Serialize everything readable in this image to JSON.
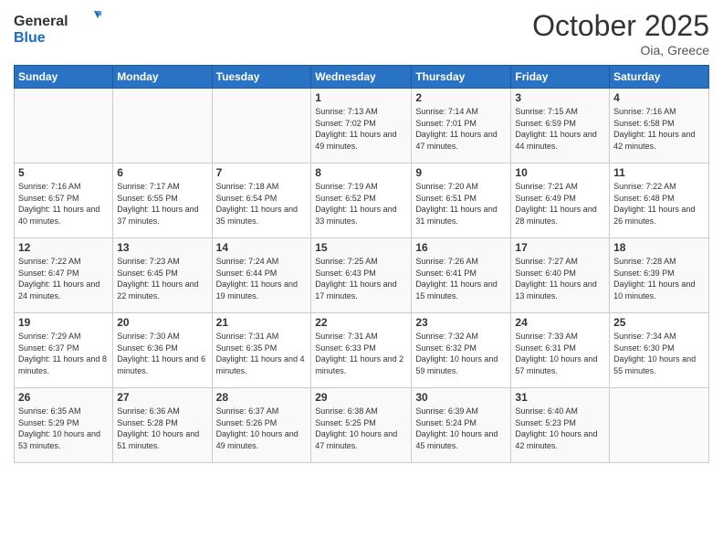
{
  "header": {
    "logo_general": "General",
    "logo_blue": "Blue",
    "month_title": "October 2025",
    "location": "Oia, Greece"
  },
  "weekdays": [
    "Sunday",
    "Monday",
    "Tuesday",
    "Wednesday",
    "Thursday",
    "Friday",
    "Saturday"
  ],
  "weeks": [
    [
      {
        "day": "",
        "sunrise": "",
        "sunset": "",
        "daylight": ""
      },
      {
        "day": "",
        "sunrise": "",
        "sunset": "",
        "daylight": ""
      },
      {
        "day": "",
        "sunrise": "",
        "sunset": "",
        "daylight": ""
      },
      {
        "day": "1",
        "sunrise": "Sunrise: 7:13 AM",
        "sunset": "Sunset: 7:02 PM",
        "daylight": "Daylight: 11 hours and 49 minutes."
      },
      {
        "day": "2",
        "sunrise": "Sunrise: 7:14 AM",
        "sunset": "Sunset: 7:01 PM",
        "daylight": "Daylight: 11 hours and 47 minutes."
      },
      {
        "day": "3",
        "sunrise": "Sunrise: 7:15 AM",
        "sunset": "Sunset: 6:59 PM",
        "daylight": "Daylight: 11 hours and 44 minutes."
      },
      {
        "day": "4",
        "sunrise": "Sunrise: 7:16 AM",
        "sunset": "Sunset: 6:58 PM",
        "daylight": "Daylight: 11 hours and 42 minutes."
      }
    ],
    [
      {
        "day": "5",
        "sunrise": "Sunrise: 7:16 AM",
        "sunset": "Sunset: 6:57 PM",
        "daylight": "Daylight: 11 hours and 40 minutes."
      },
      {
        "day": "6",
        "sunrise": "Sunrise: 7:17 AM",
        "sunset": "Sunset: 6:55 PM",
        "daylight": "Daylight: 11 hours and 37 minutes."
      },
      {
        "day": "7",
        "sunrise": "Sunrise: 7:18 AM",
        "sunset": "Sunset: 6:54 PM",
        "daylight": "Daylight: 11 hours and 35 minutes."
      },
      {
        "day": "8",
        "sunrise": "Sunrise: 7:19 AM",
        "sunset": "Sunset: 6:52 PM",
        "daylight": "Daylight: 11 hours and 33 minutes."
      },
      {
        "day": "9",
        "sunrise": "Sunrise: 7:20 AM",
        "sunset": "Sunset: 6:51 PM",
        "daylight": "Daylight: 11 hours and 31 minutes."
      },
      {
        "day": "10",
        "sunrise": "Sunrise: 7:21 AM",
        "sunset": "Sunset: 6:49 PM",
        "daylight": "Daylight: 11 hours and 28 minutes."
      },
      {
        "day": "11",
        "sunrise": "Sunrise: 7:22 AM",
        "sunset": "Sunset: 6:48 PM",
        "daylight": "Daylight: 11 hours and 26 minutes."
      }
    ],
    [
      {
        "day": "12",
        "sunrise": "Sunrise: 7:22 AM",
        "sunset": "Sunset: 6:47 PM",
        "daylight": "Daylight: 11 hours and 24 minutes."
      },
      {
        "day": "13",
        "sunrise": "Sunrise: 7:23 AM",
        "sunset": "Sunset: 6:45 PM",
        "daylight": "Daylight: 11 hours and 22 minutes."
      },
      {
        "day": "14",
        "sunrise": "Sunrise: 7:24 AM",
        "sunset": "Sunset: 6:44 PM",
        "daylight": "Daylight: 11 hours and 19 minutes."
      },
      {
        "day": "15",
        "sunrise": "Sunrise: 7:25 AM",
        "sunset": "Sunset: 6:43 PM",
        "daylight": "Daylight: 11 hours and 17 minutes."
      },
      {
        "day": "16",
        "sunrise": "Sunrise: 7:26 AM",
        "sunset": "Sunset: 6:41 PM",
        "daylight": "Daylight: 11 hours and 15 minutes."
      },
      {
        "day": "17",
        "sunrise": "Sunrise: 7:27 AM",
        "sunset": "Sunset: 6:40 PM",
        "daylight": "Daylight: 11 hours and 13 minutes."
      },
      {
        "day": "18",
        "sunrise": "Sunrise: 7:28 AM",
        "sunset": "Sunset: 6:39 PM",
        "daylight": "Daylight: 11 hours and 10 minutes."
      }
    ],
    [
      {
        "day": "19",
        "sunrise": "Sunrise: 7:29 AM",
        "sunset": "Sunset: 6:37 PM",
        "daylight": "Daylight: 11 hours and 8 minutes."
      },
      {
        "day": "20",
        "sunrise": "Sunrise: 7:30 AM",
        "sunset": "Sunset: 6:36 PM",
        "daylight": "Daylight: 11 hours and 6 minutes."
      },
      {
        "day": "21",
        "sunrise": "Sunrise: 7:31 AM",
        "sunset": "Sunset: 6:35 PM",
        "daylight": "Daylight: 11 hours and 4 minutes."
      },
      {
        "day": "22",
        "sunrise": "Sunrise: 7:31 AM",
        "sunset": "Sunset: 6:33 PM",
        "daylight": "Daylight: 11 hours and 2 minutes."
      },
      {
        "day": "23",
        "sunrise": "Sunrise: 7:32 AM",
        "sunset": "Sunset: 6:32 PM",
        "daylight": "Daylight: 10 hours and 59 minutes."
      },
      {
        "day": "24",
        "sunrise": "Sunrise: 7:33 AM",
        "sunset": "Sunset: 6:31 PM",
        "daylight": "Daylight: 10 hours and 57 minutes."
      },
      {
        "day": "25",
        "sunrise": "Sunrise: 7:34 AM",
        "sunset": "Sunset: 6:30 PM",
        "daylight": "Daylight: 10 hours and 55 minutes."
      }
    ],
    [
      {
        "day": "26",
        "sunrise": "Sunrise: 6:35 AM",
        "sunset": "Sunset: 5:29 PM",
        "daylight": "Daylight: 10 hours and 53 minutes."
      },
      {
        "day": "27",
        "sunrise": "Sunrise: 6:36 AM",
        "sunset": "Sunset: 5:28 PM",
        "daylight": "Daylight: 10 hours and 51 minutes."
      },
      {
        "day": "28",
        "sunrise": "Sunrise: 6:37 AM",
        "sunset": "Sunset: 5:26 PM",
        "daylight": "Daylight: 10 hours and 49 minutes."
      },
      {
        "day": "29",
        "sunrise": "Sunrise: 6:38 AM",
        "sunset": "Sunset: 5:25 PM",
        "daylight": "Daylight: 10 hours and 47 minutes."
      },
      {
        "day": "30",
        "sunrise": "Sunrise: 6:39 AM",
        "sunset": "Sunset: 5:24 PM",
        "daylight": "Daylight: 10 hours and 45 minutes."
      },
      {
        "day": "31",
        "sunrise": "Sunrise: 6:40 AM",
        "sunset": "Sunset: 5:23 PM",
        "daylight": "Daylight: 10 hours and 42 minutes."
      },
      {
        "day": "",
        "sunrise": "",
        "sunset": "",
        "daylight": ""
      }
    ]
  ]
}
